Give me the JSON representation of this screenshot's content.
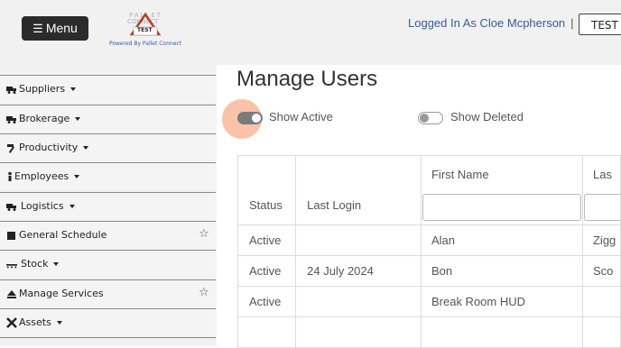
{
  "header": {
    "menu_label": "Menu",
    "logo_text": "PALLET CONNECT",
    "logo_badge": "TEST",
    "powered_by": "Powered By Pallet Connect",
    "logged_in": "Logged In As Cloe Mcpherson",
    "separator": "|",
    "env_button": "TEST A"
  },
  "sidebar": {
    "items": [
      {
        "label": "Suppliers",
        "icon": "truck-icon",
        "caret": true,
        "star": false
      },
      {
        "label": "Brokerage",
        "icon": "truck-icon",
        "caret": true,
        "star": false
      },
      {
        "label": "Productivity",
        "icon": "hammer-icon",
        "caret": true,
        "star": false
      },
      {
        "label": "Employees",
        "icon": "person-icon",
        "caret": true,
        "star": false
      },
      {
        "label": "Logistics",
        "icon": "truck-icon",
        "caret": true,
        "star": false
      },
      {
        "label": "General Schedule",
        "icon": "calendar-icon",
        "caret": false,
        "star": true
      },
      {
        "label": "Stock",
        "icon": "pallet-icon",
        "caret": true,
        "star": false
      },
      {
        "label": "Manage Services",
        "icon": "eject-icon",
        "caret": false,
        "star": true
      },
      {
        "label": "Assets",
        "icon": "tools-icon",
        "caret": true,
        "star": false
      }
    ]
  },
  "main": {
    "title": "Manage Users",
    "show_active": {
      "label": "Show Active",
      "on": true
    },
    "show_deleted": {
      "label": "Show Deleted",
      "on": false
    },
    "table": {
      "columns": [
        "Status",
        "Last Login",
        "First Name",
        "Las"
      ],
      "rows": [
        [
          "Active",
          "",
          "Alan",
          "Zigg"
        ],
        [
          "Active",
          "24 July 2024",
          "Bon",
          "Sco"
        ],
        [
          "Active",
          "",
          "Break Room HUD",
          ""
        ],
        [
          "",
          "",
          "",
          ""
        ]
      ]
    }
  },
  "colors": {
    "accent_halo": "#f48f63",
    "menu_bg": "#2b2b2b",
    "link": "#3a5a9c"
  }
}
